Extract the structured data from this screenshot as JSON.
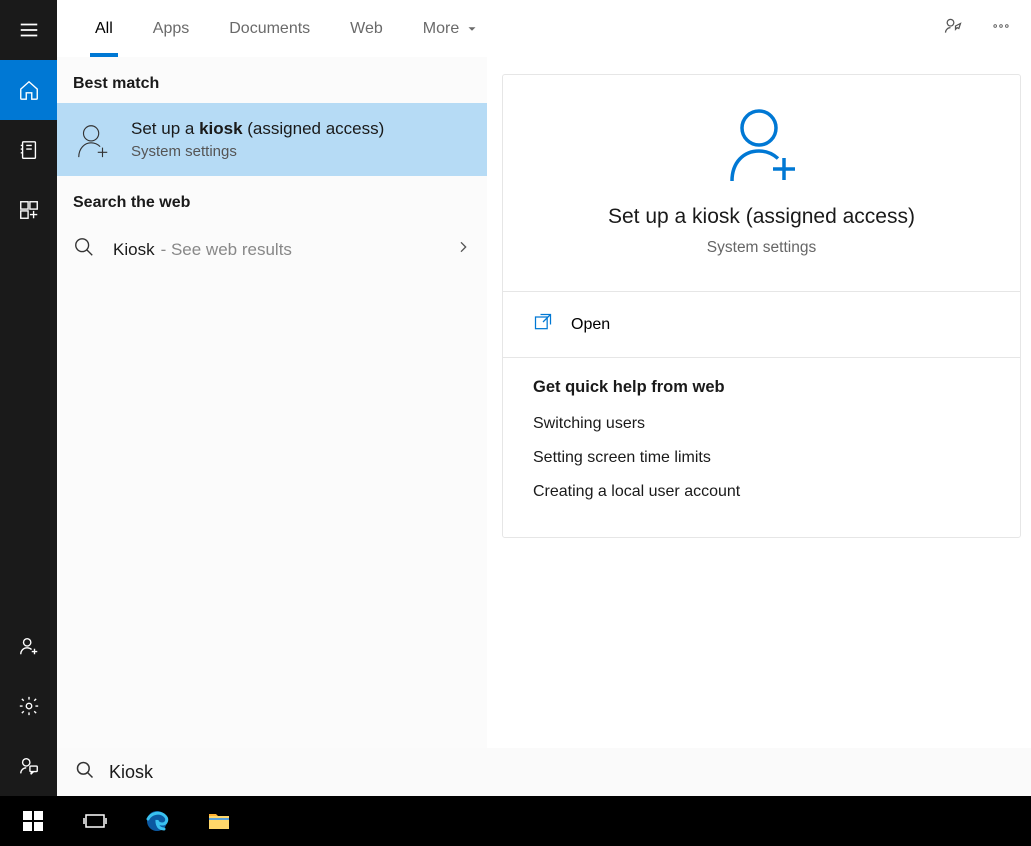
{
  "tabs": {
    "all": "All",
    "apps": "Apps",
    "documents": "Documents",
    "web": "Web",
    "more": "More"
  },
  "sections": {
    "best_match": "Best match",
    "search_web": "Search the web"
  },
  "result": {
    "title_pre": "Set up a ",
    "title_bold": "kiosk",
    "title_post": " (assigned access)",
    "subtitle": "System settings"
  },
  "webrow": {
    "query": "Kiosk",
    "suffix": "- See web results"
  },
  "preview": {
    "title": "Set up a kiosk (assigned access)",
    "subtitle": "System settings",
    "open": "Open",
    "help_header": "Get quick help from web",
    "links": {
      "l1": "Switching users",
      "l2": "Setting screen time limits",
      "l3": "Creating a local user account"
    }
  },
  "search": {
    "value": "Kiosk"
  }
}
